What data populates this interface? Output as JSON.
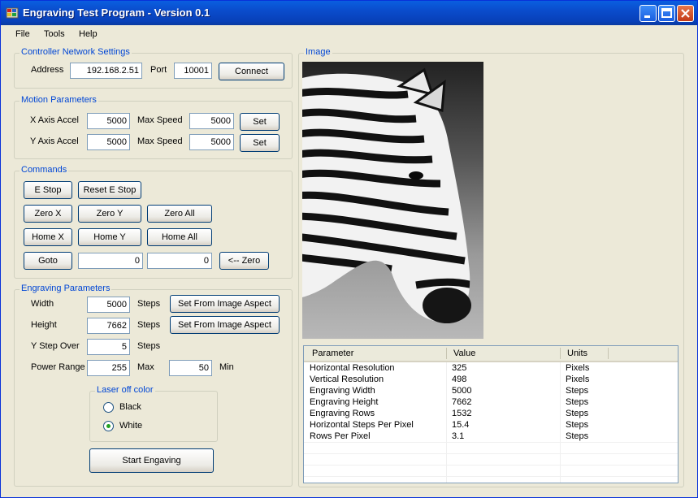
{
  "window": {
    "title": "Engraving Test Program - Version 0.1"
  },
  "menu": [
    "File",
    "Tools",
    "Help"
  ],
  "controller": {
    "group_label": "Controller Network Settings",
    "address_label": "Address",
    "address_value": "192.168.2.51",
    "port_label": "Port",
    "port_value": "10001",
    "connect_label": "Connect"
  },
  "motion": {
    "group_label": "Motion Parameters",
    "x_accel_label": "X Axis Accel",
    "x_accel_value": "5000",
    "x_max_label": "Max Speed",
    "x_max_value": "5000",
    "x_set_label": "Set",
    "y_accel_label": "Y Axis Accel",
    "y_accel_value": "5000",
    "y_max_label": "Max Speed",
    "y_max_value": "5000",
    "y_set_label": "Set"
  },
  "commands": {
    "group_label": "Commands",
    "estop": "E Stop",
    "reset_estop": "Reset E Stop",
    "zero_x": "Zero X",
    "zero_y": "Zero Y",
    "zero_all": "Zero All",
    "home_x": "Home X",
    "home_y": "Home Y",
    "home_all": "Home All",
    "goto": "Goto",
    "goto_x_value": "0",
    "goto_y_value": "0",
    "zero_arrow": "<-- Zero"
  },
  "engraving": {
    "group_label": "Engraving Parameters",
    "width_label": "Width",
    "width_value": "5000",
    "width_units": "Steps",
    "width_btn": "Set From Image Aspect",
    "height_label": "Height",
    "height_value": "7662",
    "height_units": "Steps",
    "height_btn": "Set From Image Aspect",
    "ystep_label": "Y Step Over",
    "ystep_value": "5",
    "ystep_units": "Steps",
    "power_label": "Power Range",
    "power_max_value": "255",
    "power_max_label": "Max",
    "power_min_value": "50",
    "power_min_label": "Min",
    "laser_group_label": "Laser off color",
    "radio_black": "Black",
    "radio_white": "White",
    "selected_color": "White",
    "start_label": "Start Engaving"
  },
  "image_panel": {
    "group_label": "Image",
    "image_subject": "zebra-photo"
  },
  "params_table": {
    "headers": [
      "Parameter",
      "Value",
      "Units"
    ],
    "rows": [
      [
        "Horizontal Resolution",
        "325",
        "Pixels"
      ],
      [
        "Vertical Resolution",
        "498",
        "Pixels"
      ],
      [
        "Engraving Width",
        "5000",
        "Steps"
      ],
      [
        "Engraving Height",
        "7662",
        "Steps"
      ],
      [
        "Engraving Rows",
        "1532",
        "Steps"
      ],
      [
        "Horizontal Steps Per Pixel",
        "15.4",
        "Steps"
      ],
      [
        "Rows Per Pixel",
        "3.1",
        "Steps"
      ]
    ]
  },
  "colors": {
    "title_bar": "#0a4ccc",
    "group_label": "#0046d5",
    "window_bg": "#ece9d8"
  }
}
